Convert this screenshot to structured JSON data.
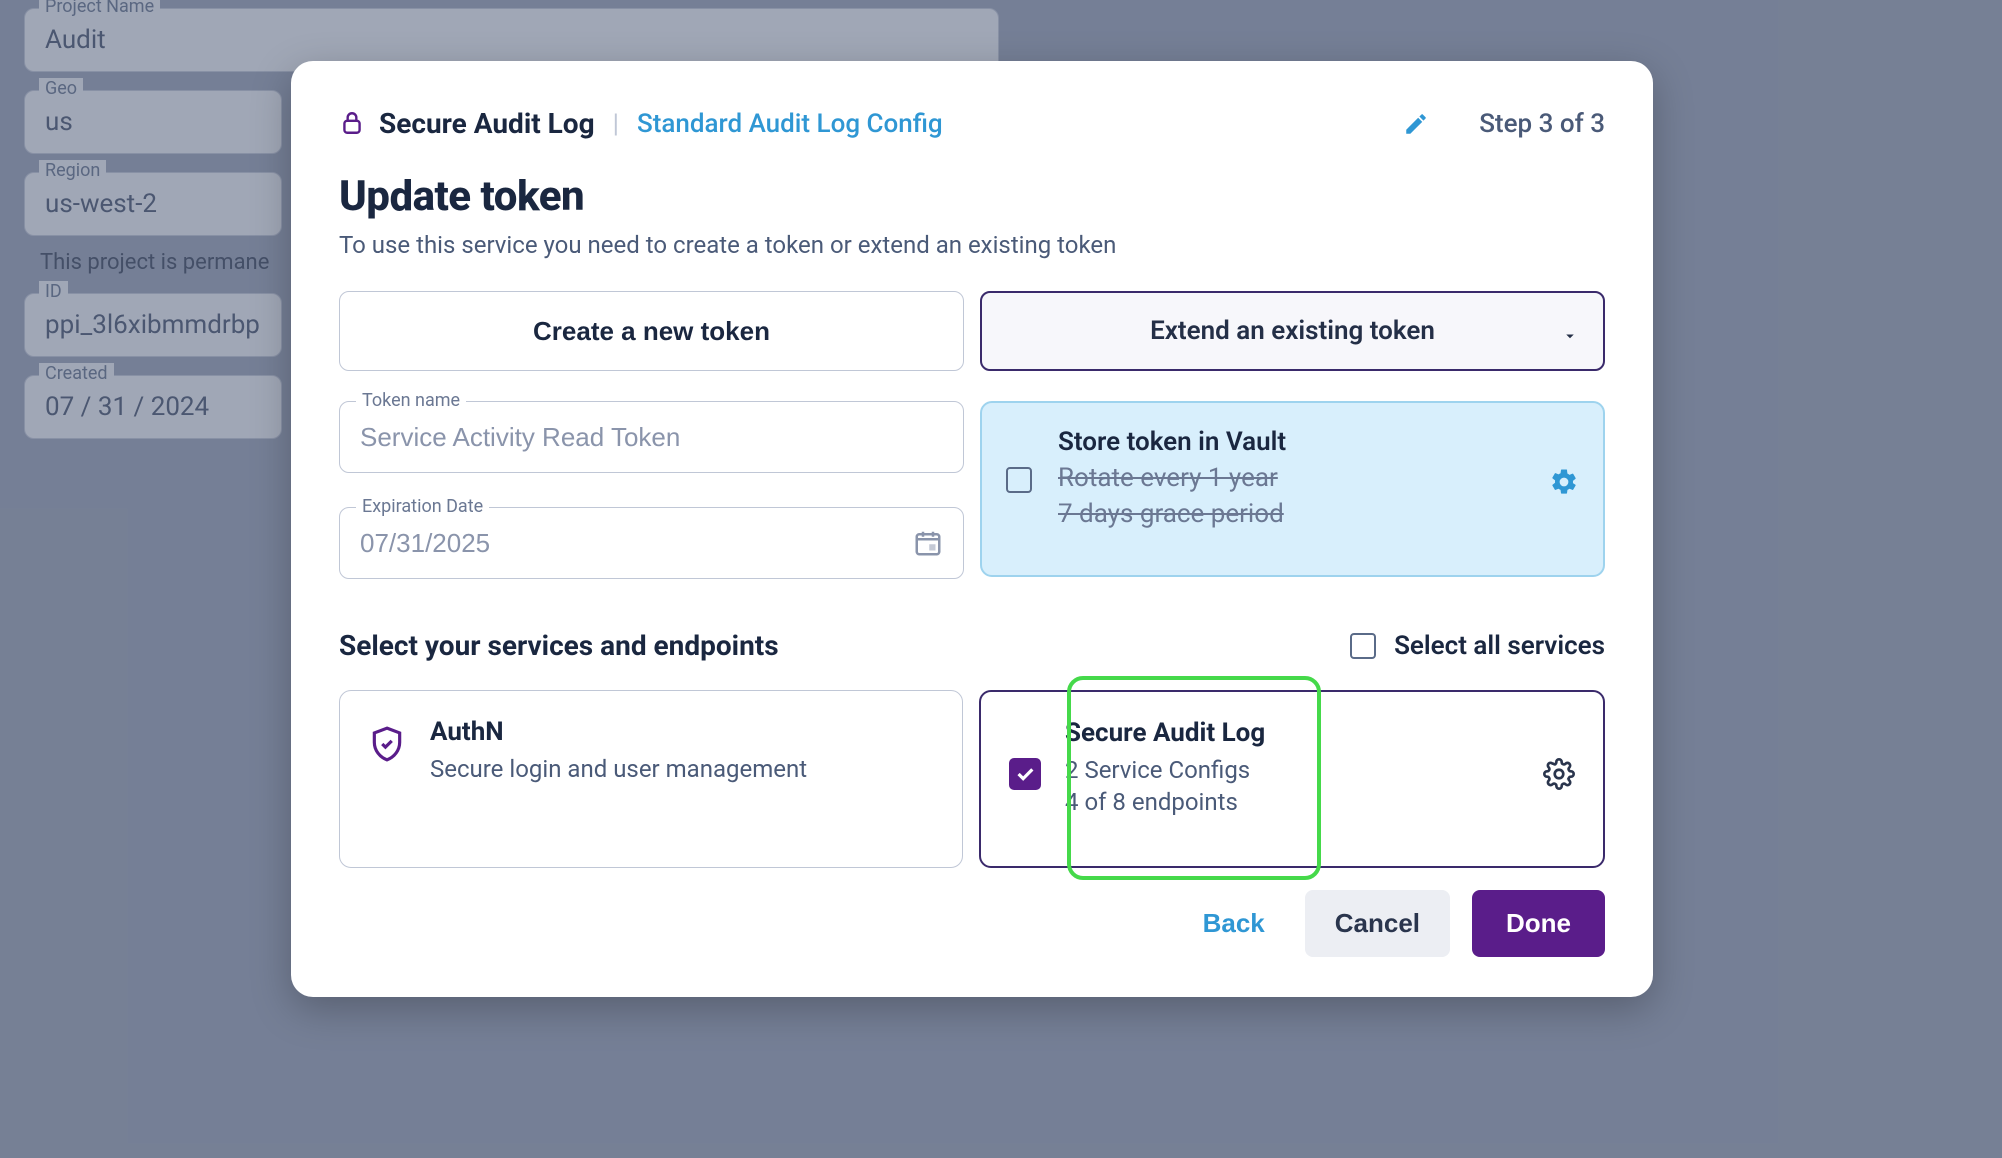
{
  "bg": {
    "project_name_label": "Project Name",
    "project_name_value": "Audit",
    "geo_label": "Geo",
    "geo_value": "us",
    "region_label": "Region",
    "region_value": "us-west-2",
    "helper_text": "This project is permane",
    "id_label": "ID",
    "id_value": "ppi_3l6xibmmdrbp",
    "created_label": "Created",
    "created_value": "07 / 31 / 2024"
  },
  "modal": {
    "header": {
      "title": "Secure Audit Log",
      "crumb": "Standard Audit Log Config",
      "step": "Step 3 of 3"
    },
    "heading": "Update token",
    "subheading": "To use this service you need to create a token or extend an existing token",
    "create_label": "Create a new token",
    "extend_label": "Extend an existing token",
    "token_name_label": "Token name",
    "token_name_placeholder": "Service Activity Read Token",
    "token_name_value": "",
    "expiration_label": "Expiration Date",
    "expiration_value": "07/31/2025",
    "vault": {
      "line1": "Store token in Vault",
      "line2": "Rotate every 1 year",
      "line3": "7 days grace period"
    },
    "services_heading": "Select your services and endpoints",
    "select_all_label": "Select all services",
    "svc_authn": {
      "name": "AuthN",
      "desc": "Secure login and user management"
    },
    "svc_audit": {
      "name": "Secure Audit Log",
      "line2": "2 Service Configs",
      "line3": "4 of 8 endpoints"
    },
    "buttons": {
      "back": "Back",
      "cancel": "Cancel",
      "done": "Done"
    }
  }
}
